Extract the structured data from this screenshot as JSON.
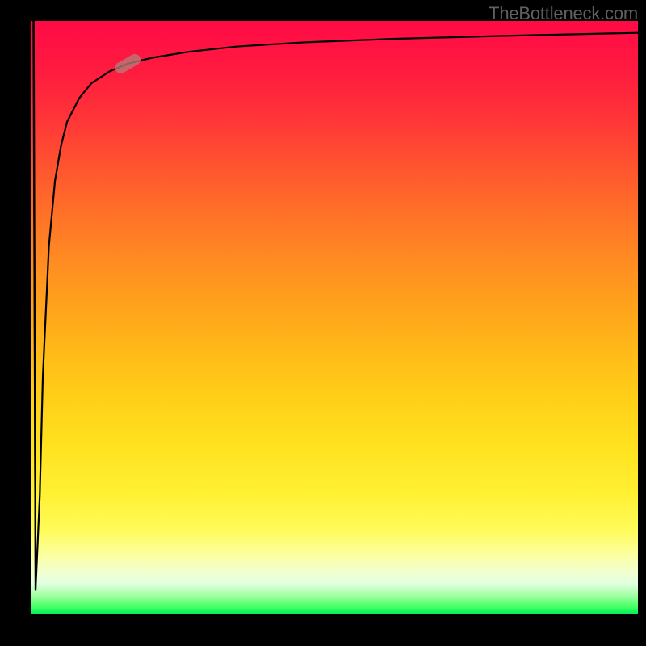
{
  "watermark": "TheBottleneck.com",
  "chart_data": {
    "type": "line",
    "title": "",
    "xlabel": "",
    "ylabel": "",
    "xlim": [
      0,
      100
    ],
    "ylim": [
      0,
      100
    ],
    "background_gradient": {
      "direction": "top-to-bottom",
      "stops": [
        {
          "pos": 0,
          "color": "#ff0a46"
        },
        {
          "pos": 50,
          "color": "#ffb118"
        },
        {
          "pos": 85,
          "color": "#fff850"
        },
        {
          "pos": 100,
          "color": "#00f058"
        }
      ]
    },
    "series": [
      {
        "name": "curve",
        "x": [
          0.5,
          0.8,
          1.5,
          2,
          3,
          4,
          5,
          6,
          8,
          10,
          13,
          16,
          20,
          26,
          34,
          45,
          60,
          78,
          100
        ],
        "y": [
          100,
          4,
          20,
          40,
          62,
          73,
          79,
          83,
          87,
          89.5,
          91.5,
          92.8,
          93.8,
          94.8,
          95.7,
          96.4,
          97,
          97.5,
          98
        ]
      }
    ],
    "marker": {
      "x": 16,
      "y": 92.8,
      "shape": "capsule",
      "angle_deg": -30,
      "color": "#b67c78"
    }
  }
}
